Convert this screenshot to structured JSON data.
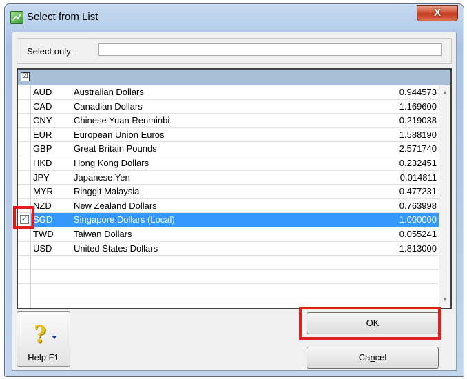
{
  "window": {
    "title": "Select from List",
    "close_glyph": "X"
  },
  "filter": {
    "label": "Select only:",
    "value": ""
  },
  "grid": {
    "header_check": "☑",
    "rows": [
      {
        "code": "AUD",
        "name": "Australian Dollars",
        "rate": "0.944573",
        "checked": false,
        "selected": false
      },
      {
        "code": "CAD",
        "name": "Canadian Dollars",
        "rate": "1.169600",
        "checked": false,
        "selected": false
      },
      {
        "code": "CNY",
        "name": "Chinese Yuan Renminbi",
        "rate": "0.219038",
        "checked": false,
        "selected": false
      },
      {
        "code": "EUR",
        "name": "European Union Euros",
        "rate": "1.588190",
        "checked": false,
        "selected": false
      },
      {
        "code": "GBP",
        "name": "Great Britain Pounds",
        "rate": "2.571740",
        "checked": false,
        "selected": false
      },
      {
        "code": "HKD",
        "name": "Hong Kong Dollars",
        "rate": "0.232451",
        "checked": false,
        "selected": false
      },
      {
        "code": "JPY",
        "name": "Japanese Yen",
        "rate": "0.014811",
        "checked": false,
        "selected": false
      },
      {
        "code": "MYR",
        "name": "Ringgit Malaysia",
        "rate": "0.477231",
        "checked": false,
        "selected": false
      },
      {
        "code": "NZD",
        "name": "New Zealand Dollars",
        "rate": "0.763998",
        "checked": false,
        "selected": false
      },
      {
        "code": "SGD",
        "name": "Singapore Dollars (Local)",
        "rate": "1.000000",
        "checked": true,
        "selected": true
      },
      {
        "code": "TWD",
        "name": "Taiwan Dollars",
        "rate": "0.055241",
        "checked": false,
        "selected": false
      },
      {
        "code": "USD",
        "name": "United States Dollars",
        "rate": "1.813000",
        "checked": false,
        "selected": false
      },
      {
        "code": "",
        "name": "",
        "rate": "",
        "checked": false,
        "selected": false
      },
      {
        "code": "",
        "name": "",
        "rate": "",
        "checked": false,
        "selected": false
      },
      {
        "code": "",
        "name": "",
        "rate": "",
        "checked": false,
        "selected": false
      },
      {
        "code": "",
        "name": "",
        "rate": "",
        "checked": false,
        "selected": false
      }
    ],
    "check_glyph": "✓",
    "scroll_up_glyph": "▲",
    "scroll_down_glyph": "▼"
  },
  "buttons": {
    "help_label": "Help F1",
    "help_glyph": "?",
    "ok_label": "OK",
    "cancel_label": "Cancel"
  },
  "colors": {
    "selection": "#3399ff",
    "highlight": "#e01e1e",
    "header": "#a8bfd6"
  }
}
